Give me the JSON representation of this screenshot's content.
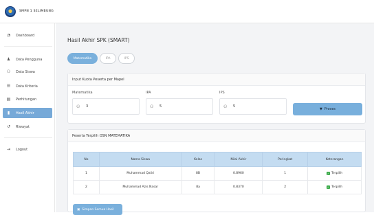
{
  "brand": {
    "name": "SMPN 1 SELIMBUNG"
  },
  "sidebar": {
    "items": [
      {
        "label": "Dashboard",
        "icon": "dashboard-icon"
      },
      {
        "label": "Data Pengguna",
        "icon": "user-icon"
      },
      {
        "label": "Data Siswa",
        "icon": "users-icon"
      },
      {
        "label": "Data Kriteria",
        "icon": "list-icon"
      },
      {
        "label": "Perhitungan",
        "icon": "calculator-icon"
      },
      {
        "label": "Hasil Akhir",
        "icon": "chart-icon"
      },
      {
        "label": "Riwayat",
        "icon": "history-icon"
      },
      {
        "label": "Logout",
        "icon": "logout-icon"
      }
    ]
  },
  "main": {
    "title": "Hasil Akhir SPK (SMART)",
    "tabs": [
      {
        "label": "Matematika",
        "active": true
      },
      {
        "label": "IPA",
        "active": false
      },
      {
        "label": "IPS",
        "active": false
      }
    ],
    "quota": {
      "heading": "Input Kuota Peserta per Mapel",
      "fields": [
        {
          "label": "Matematika",
          "value": "3"
        },
        {
          "label": "IPA",
          "value": "5"
        },
        {
          "label": "IPS",
          "value": "5"
        }
      ],
      "process_label": "Proses"
    },
    "results": {
      "heading": "Peserta Terpilih OSN MATEMATIKA",
      "columns": [
        "No",
        "Nama Siswa",
        "Kelas",
        "Nilai Akhir",
        "Peringkat",
        "Keterangan"
      ],
      "rows": [
        {
          "no": "1",
          "name": "Muhammad Qaiiri",
          "kelas": "8B",
          "nilai": "0.8960",
          "peringkat": "1",
          "ket": "Terpilih"
        },
        {
          "no": "2",
          "name": "Muhammad Azis Nasar",
          "kelas": "8a",
          "nilai": "0.8370",
          "peringkat": "2",
          "ket": "Terpilih"
        }
      ],
      "save_label": "Simpan Semua Hasil"
    }
  },
  "colors": {
    "accent": "#7ab0dc",
    "active_nav": "#76a9d8",
    "table_head": "#c4dcf1",
    "check": "#3cab4a"
  }
}
